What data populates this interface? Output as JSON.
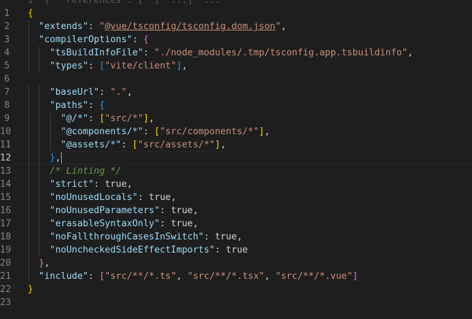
{
  "editor": {
    "top_cut_text": "1  {  \"references\": [ \"[\" ...] \"...",
    "current_line": 12,
    "lines": [
      {
        "n": "1",
        "tokens": [
          {
            "t": "{",
            "c": "b1"
          }
        ]
      },
      {
        "n": "2",
        "tokens": [
          {
            "t": "  "
          },
          {
            "t": "\"extends\"",
            "c": "key"
          },
          {
            "t": ": "
          },
          {
            "t": "\"",
            "c": "str"
          },
          {
            "t": "@vue/tsconfig/tsconfig.dom.json",
            "c": "link"
          },
          {
            "t": "\"",
            "c": "str"
          },
          {
            "t": ","
          }
        ]
      },
      {
        "n": "3",
        "tokens": [
          {
            "t": "  "
          },
          {
            "t": "\"compilerOptions\"",
            "c": "key"
          },
          {
            "t": ": "
          },
          {
            "t": "{",
            "c": "b2"
          }
        ]
      },
      {
        "n": "4",
        "tokens": [
          {
            "t": "    "
          },
          {
            "t": "\"tsBuildInfoFile\"",
            "c": "key"
          },
          {
            "t": ": "
          },
          {
            "t": "\"./node_modules/.tmp/tsconfig.app.tsbuildinfo\"",
            "c": "str"
          },
          {
            "t": ","
          }
        ]
      },
      {
        "n": "5",
        "tokens": [
          {
            "t": "    "
          },
          {
            "t": "\"types\"",
            "c": "key"
          },
          {
            "t": ": "
          },
          {
            "t": "[",
            "c": "b3"
          },
          {
            "t": "\"vite/client\"",
            "c": "str"
          },
          {
            "t": "]",
            "c": "b3"
          },
          {
            "t": ","
          }
        ]
      },
      {
        "n": "6",
        "tokens": []
      },
      {
        "n": "7",
        "tokens": [
          {
            "t": "    "
          },
          {
            "t": "\"baseUrl\"",
            "c": "key"
          },
          {
            "t": ": "
          },
          {
            "t": "\".\"",
            "c": "str"
          },
          {
            "t": ","
          }
        ]
      },
      {
        "n": "8",
        "tokens": [
          {
            "t": "    "
          },
          {
            "t": "\"paths\"",
            "c": "key"
          },
          {
            "t": ": "
          },
          {
            "t": "{",
            "c": "b3"
          }
        ]
      },
      {
        "n": "9",
        "tokens": [
          {
            "t": "      "
          },
          {
            "t": "\"@/*\"",
            "c": "key"
          },
          {
            "t": ": "
          },
          {
            "t": "[",
            "c": "b1"
          },
          {
            "t": "\"src/*\"",
            "c": "str"
          },
          {
            "t": "]",
            "c": "b1"
          },
          {
            "t": ","
          }
        ]
      },
      {
        "n": "10",
        "tokens": [
          {
            "t": "      "
          },
          {
            "t": "\"@components/*\"",
            "c": "key"
          },
          {
            "t": ": "
          },
          {
            "t": "[",
            "c": "b1"
          },
          {
            "t": "\"src/components/*\"",
            "c": "str"
          },
          {
            "t": "]",
            "c": "b1"
          },
          {
            "t": ","
          }
        ]
      },
      {
        "n": "11",
        "tokens": [
          {
            "t": "      "
          },
          {
            "t": "\"@assets/*\"",
            "c": "key"
          },
          {
            "t": ": "
          },
          {
            "t": "[",
            "c": "b1"
          },
          {
            "t": "\"src/assets/*\"",
            "c": "str"
          },
          {
            "t": "]",
            "c": "b1"
          },
          {
            "t": ","
          }
        ]
      },
      {
        "n": "12",
        "tokens": [
          {
            "t": "    "
          },
          {
            "t": "}",
            "c": "b3"
          },
          {
            "t": ","
          },
          {
            "t": "",
            "c": "cursor"
          }
        ]
      },
      {
        "n": "13",
        "tokens": [
          {
            "t": "    "
          },
          {
            "t": "/* Linting */",
            "c": "cmt"
          }
        ]
      },
      {
        "n": "14",
        "tokens": [
          {
            "t": "    "
          },
          {
            "t": "\"strict\"",
            "c": "key"
          },
          {
            "t": ": "
          },
          {
            "t": "true",
            "c": "kw"
          },
          {
            "t": ","
          }
        ]
      },
      {
        "n": "15",
        "tokens": [
          {
            "t": "    "
          },
          {
            "t": "\"noUnusedLocals\"",
            "c": "key"
          },
          {
            "t": ": "
          },
          {
            "t": "true",
            "c": "kw"
          },
          {
            "t": ","
          }
        ]
      },
      {
        "n": "16",
        "tokens": [
          {
            "t": "    "
          },
          {
            "t": "\"noUnusedParameters\"",
            "c": "key"
          },
          {
            "t": ": "
          },
          {
            "t": "true",
            "c": "kw"
          },
          {
            "t": ","
          }
        ]
      },
      {
        "n": "17",
        "tokens": [
          {
            "t": "    "
          },
          {
            "t": "\"erasableSyntaxOnly\"",
            "c": "key"
          },
          {
            "t": ": "
          },
          {
            "t": "true",
            "c": "kw"
          },
          {
            "t": ","
          }
        ]
      },
      {
        "n": "18",
        "tokens": [
          {
            "t": "    "
          },
          {
            "t": "\"noFallthroughCasesInSwitch\"",
            "c": "key"
          },
          {
            "t": ": "
          },
          {
            "t": "true",
            "c": "kw"
          },
          {
            "t": ","
          }
        ]
      },
      {
        "n": "19",
        "tokens": [
          {
            "t": "    "
          },
          {
            "t": "\"noUncheckedSideEffectImports\"",
            "c": "key"
          },
          {
            "t": ": "
          },
          {
            "t": "true",
            "c": "kw"
          }
        ]
      },
      {
        "n": "20",
        "tokens": [
          {
            "t": "  "
          },
          {
            "t": "}",
            "c": "b2"
          },
          {
            "t": ","
          }
        ]
      },
      {
        "n": "21",
        "tokens": [
          {
            "t": "  "
          },
          {
            "t": "\"include\"",
            "c": "key"
          },
          {
            "t": ": "
          },
          {
            "t": "[",
            "c": "b2"
          },
          {
            "t": "\"src/**/*.ts\"",
            "c": "str"
          },
          {
            "t": ", "
          },
          {
            "t": "\"src/**/*.tsx\"",
            "c": "str"
          },
          {
            "t": ", "
          },
          {
            "t": "\"src/**/*.vue\"",
            "c": "str"
          },
          {
            "t": "]",
            "c": "b2"
          }
        ]
      },
      {
        "n": "22",
        "tokens": [
          {
            "t": "}",
            "c": "b1"
          }
        ]
      },
      {
        "n": "23",
        "tokens": []
      }
    ]
  },
  "colors": {
    "background": "#1e1e1e",
    "key": "#9cdcfe",
    "string": "#ce9178",
    "comment": "#6a9955",
    "bracket_gold": "#ffd700",
    "bracket_purple": "#da70d6",
    "bracket_blue": "#179fff"
  }
}
